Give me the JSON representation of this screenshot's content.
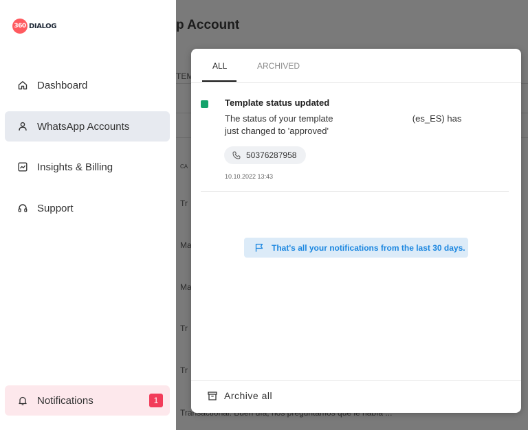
{
  "logo": {
    "badge": "360",
    "text": "DIALOG"
  },
  "sidebar": {
    "items": [
      {
        "label": "Dashboard",
        "icon": "home-icon"
      },
      {
        "label": "WhatsApp Accounts",
        "icon": "user-icon",
        "active": true
      },
      {
        "label": "Insights & Billing",
        "icon": "chart-icon"
      },
      {
        "label": "Support",
        "icon": "headset-icon"
      }
    ],
    "notifications": {
      "label": "Notifications",
      "count": "1",
      "icon": "bell-icon"
    }
  },
  "background_page": {
    "title_fragment": "p Account",
    "column_fragment": "TEM",
    "header_fragment": "CA",
    "row_fragments": [
      "Tr",
      "Ma",
      "Ma",
      "Tr",
      "Tr"
    ],
    "footer_row": "Transactional: Buen día, nos preguntamos que le había ..."
  },
  "notifications_panel": {
    "tabs": [
      {
        "label": "ALL",
        "active": true
      },
      {
        "label": "ARCHIVED",
        "active": false
      }
    ],
    "item": {
      "status_color": "#14a36b",
      "title": "Template status updated",
      "body_start": "The status of your template",
      "body_locale": "(es_ES) has",
      "body_end": "just changed to 'approved'",
      "phone": "50376287958",
      "timestamp": "10.10.2022 13:43"
    },
    "info_message": "That's all your notifications from the last 30 days.",
    "archive_all_label": "Archive all"
  },
  "colors": {
    "accent": "#1a86e0",
    "badge": "#f23c5a",
    "active_bg": "#e7eaf0",
    "notif_bg": "#fde8ec",
    "overlay": "#7a7a7a"
  }
}
